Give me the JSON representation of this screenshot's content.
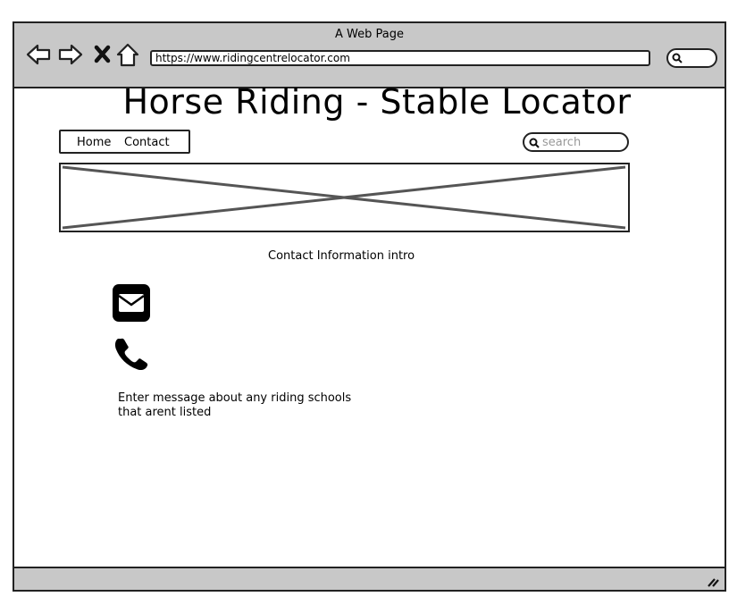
{
  "browser": {
    "window_title": "A Web Page",
    "url": "https://www.ridingcentrelocator.com"
  },
  "page": {
    "title": "Horse Riding - Stable Locator",
    "nav": {
      "home_label": "Home",
      "contact_label": "Contact"
    },
    "search": {
      "placeholder": "search"
    },
    "contact_intro": "Contact Information intro",
    "message": "Enter message about any riding schools that arent listed"
  },
  "icons": {
    "back": "back-arrow-icon",
    "forward": "forward-arrow-icon",
    "stop": "close-icon",
    "home": "home-icon",
    "search": "search-icon",
    "email": "email-icon",
    "phone": "phone-icon",
    "banner": "image-placeholder-icon",
    "resize": "resize-grip-icon"
  },
  "colors": {
    "chrome": "#c8c8c8",
    "stroke": "#222222",
    "placeholder_text": "#999999"
  }
}
